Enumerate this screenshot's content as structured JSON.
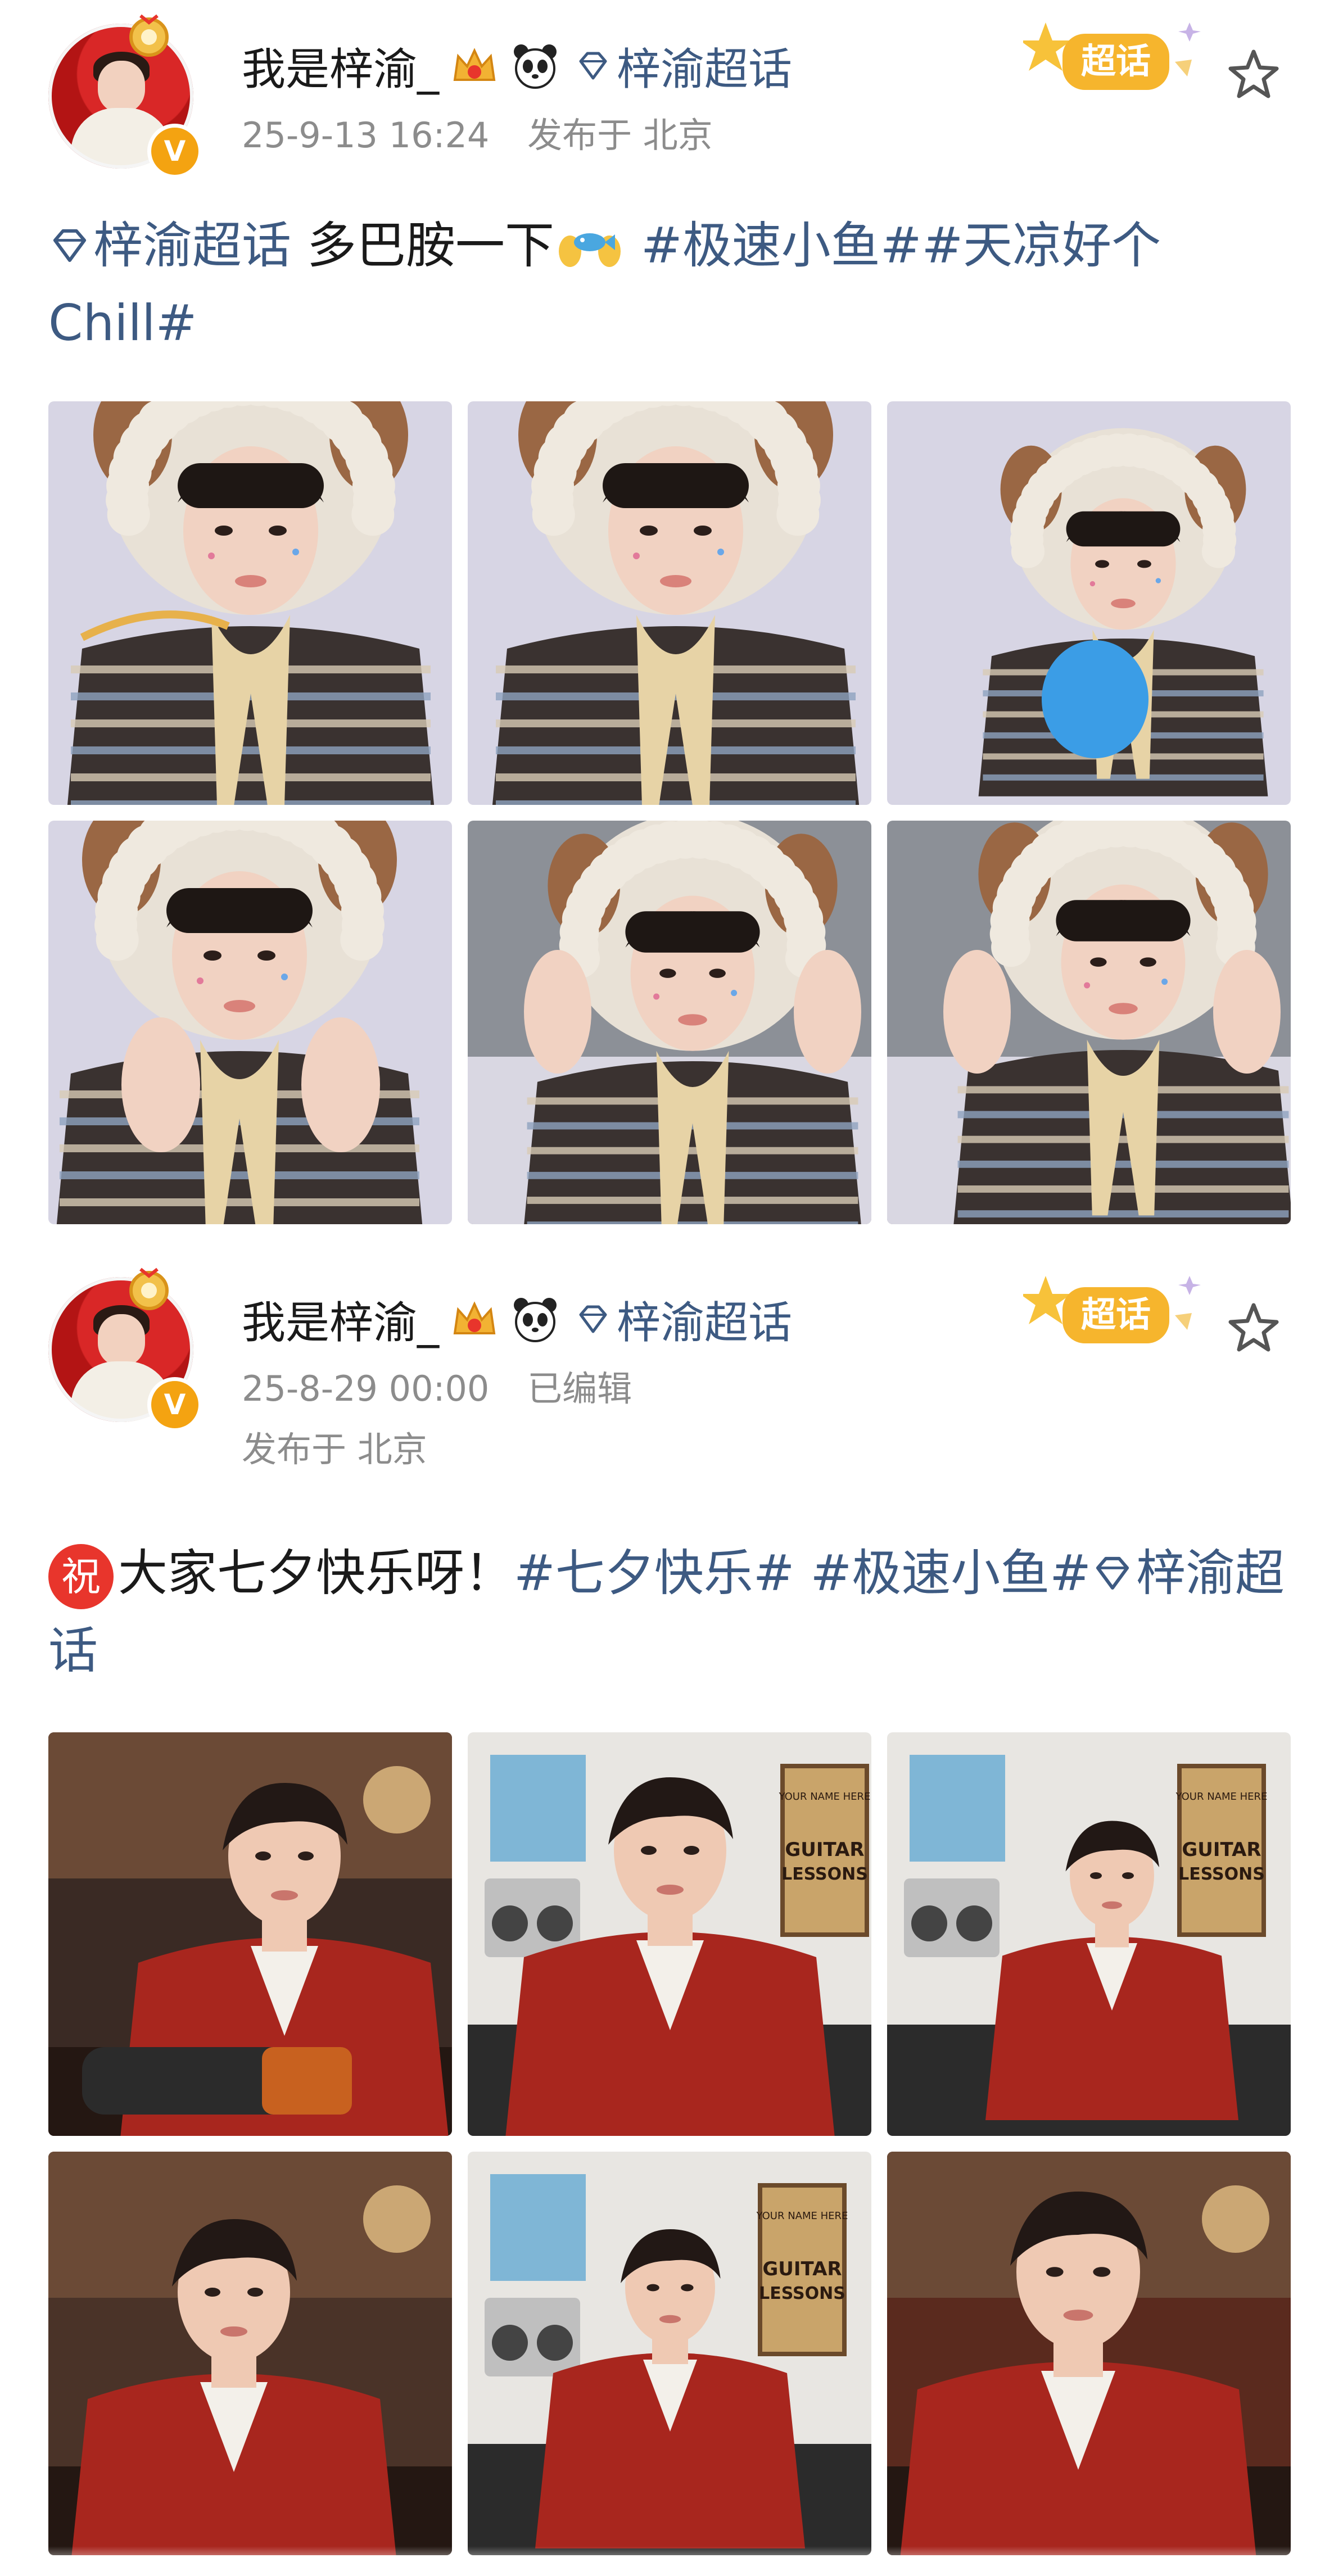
{
  "posts": [
    {
      "author": {
        "name": "我是梓渝_",
        "verified_mark": "V",
        "badges": [
          "crown-vip-icon",
          "panda-icon"
        ],
        "supertopic": "梓渝超话"
      },
      "time": "25-9-13 16:24",
      "location": "发布于 北京",
      "edited": "",
      "tag_label": "超话",
      "text": {
        "supertopic": "梓渝超话",
        "body": " 多巴胺一下",
        "emoji": "fish-hands-emoji",
        "hashtags": " #极速小鱼##天凉好个Chill#"
      },
      "photos": [
        {
          "icon": "photo",
          "scene": "fur-hat-ribbon"
        },
        {
          "icon": "photo",
          "scene": "fur-hat-hand"
        },
        {
          "icon": "photo",
          "scene": "fur-hat-balloon"
        },
        {
          "icon": "photo",
          "scene": "fur-hat-hands-cheeks"
        },
        {
          "icon": "photo",
          "scene": "fur-hat-hold-ears"
        },
        {
          "icon": "photo",
          "scene": "fur-hat-hold-ears-2"
        }
      ],
      "colors": {
        "bg": "#d7d5e4",
        "hat": "#e8e1d6",
        "sweater": "#3a3230"
      }
    },
    {
      "author": {
        "name": "我是梓渝_",
        "verified_mark": "V",
        "badges": [
          "crown-vip-icon",
          "panda-icon"
        ],
        "supertopic": "梓渝超话"
      },
      "time": "25-8-29 00:00",
      "edited": "已编辑",
      "location": "发布于 北京",
      "tag_label": "超话",
      "text": {
        "icon_char": "祝",
        "body": "大家七夕快乐呀！",
        "hashtags": "#七夕快乐# #极速小鱼#",
        "supertopic": "梓渝超话"
      },
      "photos": [
        {
          "icon": "photo",
          "scene": "red-jacket-motorcycle"
        },
        {
          "icon": "photo",
          "scene": "red-jacket-radio"
        },
        {
          "icon": "photo",
          "scene": "red-jacket-sitting"
        },
        {
          "icon": "photo",
          "scene": "red-jacket-sunlight"
        },
        {
          "icon": "photo",
          "scene": "red-jacket-guitar-sign"
        },
        {
          "icon": "photo",
          "scene": "red-jacket-portrait"
        }
      ],
      "guitar_sign": {
        "line1": "YOUR NAME HERE",
        "line2": "GUITAR",
        "line3": "LESSONS"
      },
      "colors": {
        "jacket": "#a8261e",
        "bg": "#e8e6e2"
      }
    }
  ]
}
